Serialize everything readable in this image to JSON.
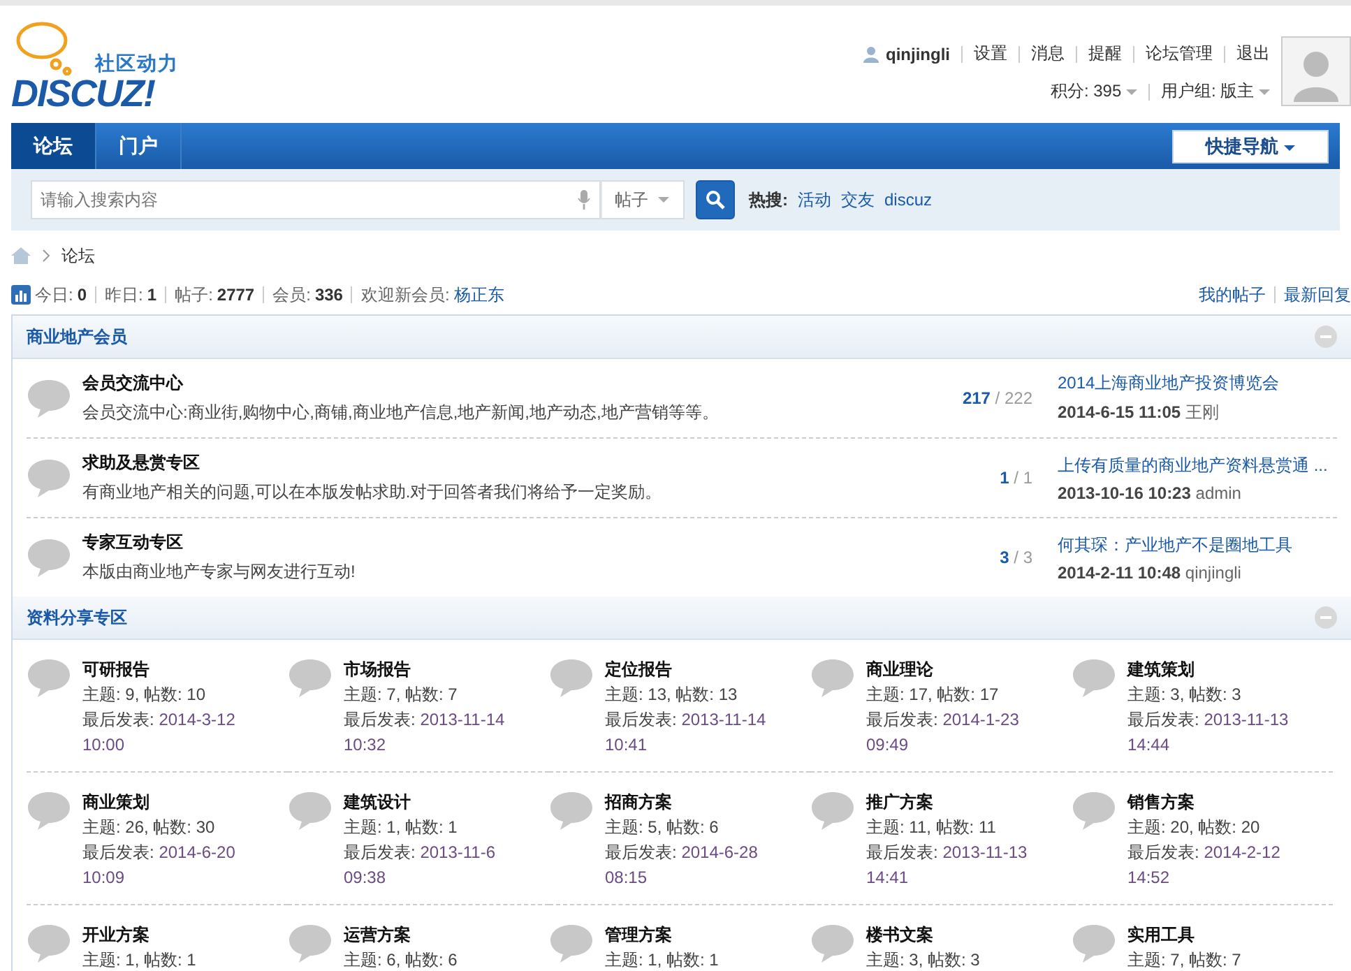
{
  "logo": {
    "tagline": "社区动力",
    "wordmark": "DISCUZ!"
  },
  "user": {
    "name": "qinjingli",
    "links": [
      "设置",
      "消息",
      "提醒",
      "论坛管理",
      "退出"
    ],
    "credits": "积分: 395",
    "group": "用户组: 版主"
  },
  "nav": {
    "tabs": [
      {
        "label": "论坛",
        "selected": true
      },
      {
        "label": "门户",
        "selected": false
      }
    ],
    "quick_nav": "快捷导航"
  },
  "search": {
    "placeholder": "请输入搜索内容",
    "type": "帖子",
    "hot_label": "热搜:",
    "hot": [
      "活动",
      "交友",
      "discuz"
    ]
  },
  "breadcrumb": "论坛",
  "stats": {
    "items": [
      {
        "label": "今日:",
        "value": "0"
      },
      {
        "label": "昨日:",
        "value": "1"
      },
      {
        "label": "帖子:",
        "value": "2777"
      },
      {
        "label": "会员:",
        "value": "336"
      }
    ],
    "welcome": "欢迎新会员:",
    "new_member": "杨正东",
    "links": [
      "我的帖子",
      "最新回复"
    ]
  },
  "categories": [
    {
      "title": "商业地产会员",
      "kind": "list",
      "forums": [
        {
          "name": "会员交流中心",
          "description": "会员交流中心:商业街,购物中心,商铺,商业地产信息,地产新闻,地产动态,地产营销等等。",
          "counts": "**217** / 222",
          "last_title": "2014上海商业地产投资博览会",
          "last_time": "2014-6-15 11:05",
          "last_user": "王刚"
        },
        {
          "name": "求助及悬赏专区",
          "description": "有商业地产相关的问题,可以在本版发帖求助.对于回答者我们将给予一定奖励。",
          "counts": "**1** / 1",
          "last_title": "上传有质量的商业地产资料悬赏通 ...",
          "last_time": "2013-10-16 10:23",
          "last_user": "admin"
        },
        {
          "name": "专家互动专区",
          "description": "本版由商业地产专家与网友进行互动!",
          "counts": "**3** / 3",
          "last_title": "何其琛：产业地产不是圈地工具",
          "last_time": "2014-2-11 10:48",
          "last_user": "qinjingli"
        }
      ]
    },
    {
      "title": "资料分享专区",
      "kind": "grid",
      "forums": [
        {
          "name": "可研报告",
          "counts": "主题: 9, 帖数: 10",
          "last_label": "最后发表:",
          "last_date": "2014-3-12",
          "last_time": "10:00"
        },
        {
          "name": "市场报告",
          "counts": "主题: 7, 帖数: 7",
          "last_label": "最后发表:",
          "last_date": "2013-11-14",
          "last_time": "10:32"
        },
        {
          "name": "定位报告",
          "counts": "主题: 13, 帖数: 13",
          "last_label": "最后发表:",
          "last_date": "2013-11-14",
          "last_time": "10:41"
        },
        {
          "name": "商业理论",
          "counts": "主题: 17, 帖数: 17",
          "last_label": "最后发表:",
          "last_date": "2014-1-23",
          "last_time": "09:49"
        },
        {
          "name": "建筑策划",
          "counts": "主题: 3, 帖数: 3",
          "last_label": "最后发表:",
          "last_date": "2013-11-13",
          "last_time": "14:44"
        },
        {
          "name": "商业策划",
          "counts": "主题: 26, 帖数: 30",
          "last_label": "最后发表:",
          "last_date": "2014-6-20",
          "last_time": "10:09"
        },
        {
          "name": "建筑设计",
          "counts": "主题: 1, 帖数: 1",
          "last_label": "最后发表:",
          "last_date": "2013-11-6",
          "last_time": "09:38"
        },
        {
          "name": "招商方案",
          "counts": "主题: 5, 帖数: 6",
          "last_label": "最后发表:",
          "last_date": "2014-6-28",
          "last_time": "08:15"
        },
        {
          "name": "推广方案",
          "counts": "主题: 11, 帖数: 11",
          "last_label": "最后发表:",
          "last_date": "2013-11-13",
          "last_time": "14:41"
        },
        {
          "name": "销售方案",
          "counts": "主题: 20, 帖数: 20",
          "last_label": "最后发表:",
          "last_date": "2014-2-12",
          "last_time": "14:52"
        },
        {
          "name": "开业方案",
          "counts": "主题: 1, 帖数: 1"
        },
        {
          "name": "运营方案",
          "counts": "主题: 6, 帖数: 6"
        },
        {
          "name": "管理方案",
          "counts": "主题: 1, 帖数: 1"
        },
        {
          "name": "楼书文案",
          "counts": "主题: 3, 帖数: 3"
        },
        {
          "name": "实用工具",
          "counts": "主题: 7, 帖数: 7"
        }
      ]
    }
  ]
}
